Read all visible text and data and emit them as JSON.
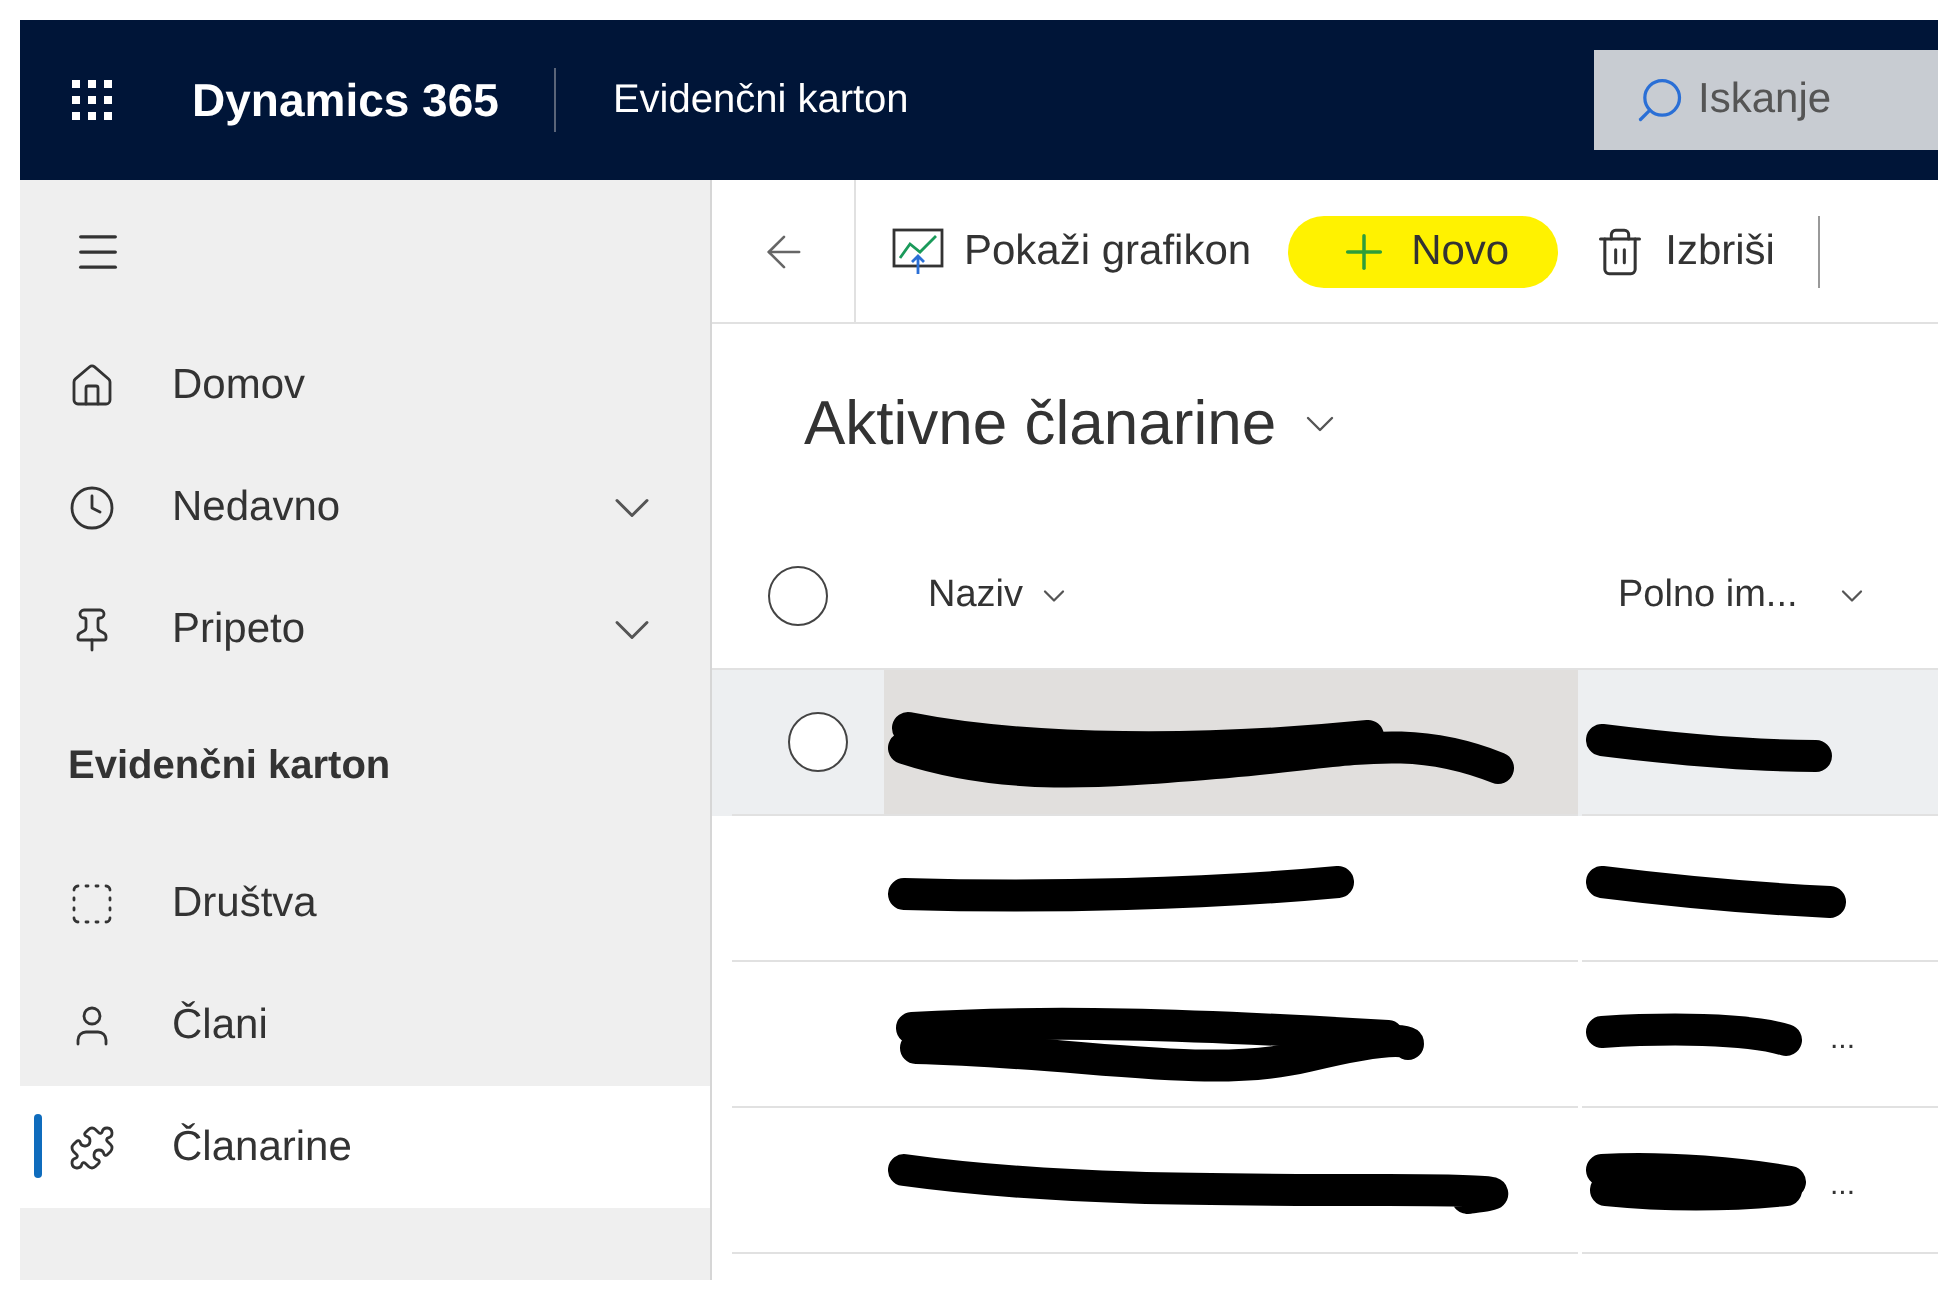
{
  "top_bar": {
    "brand": "Dynamics 365",
    "app_name": "Evidenčni karton",
    "search": {
      "placeholder": "Iskanje"
    }
  },
  "sidebar": {
    "items": [
      {
        "kind": "link",
        "label": "Domov",
        "expandable": false,
        "selected": false
      },
      {
        "kind": "link",
        "label": "Nedavno",
        "expandable": true,
        "selected": false
      },
      {
        "kind": "link",
        "label": "Pripeto",
        "expandable": true,
        "selected": false
      },
      {
        "kind": "section",
        "label": "Evidenčni karton"
      },
      {
        "kind": "link",
        "label": "Društva",
        "expandable": false,
        "selected": false
      },
      {
        "kind": "link",
        "label": "Člani",
        "expandable": false,
        "selected": false
      },
      {
        "kind": "link",
        "label": "Članarine",
        "expandable": false,
        "selected": true
      }
    ]
  },
  "command_bar": {
    "buttons": [
      {
        "label": "Pokaži grafikon",
        "highlighted": false
      },
      {
        "label": "Novo",
        "highlighted": true
      },
      {
        "label": "Izbriši",
        "highlighted": false
      }
    ]
  },
  "view": {
    "title": "Aktivne članarine",
    "table": {
      "select_all": {
        "checked": false
      },
      "columns": [
        "Naziv",
        "Polno im..."
      ],
      "rows": [
        {
          "hovered": true,
          "redacted": true
        },
        {
          "hovered": false,
          "redacted": true
        },
        {
          "hovered": false,
          "redacted": true,
          "column_2_tail": "..."
        },
        {
          "hovered": false,
          "redacted": true,
          "column_2_tail": "..."
        }
      ]
    }
  }
}
